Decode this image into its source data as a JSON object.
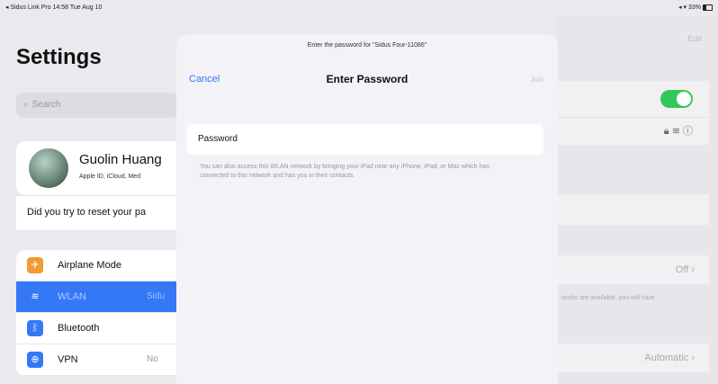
{
  "status_bar": {
    "left": "◂ Sidus Link Pro  14:58  Tue Aug 10",
    "right": "◂ ▾ 33%",
    "battery_icon": "battery-icon"
  },
  "sidebar": {
    "title": "Settings",
    "search_placeholder": "Search",
    "profile": {
      "name": "Guolin Huang",
      "subtitle": "Apple ID, iCloud, Med"
    },
    "suggestion": "Did you try to reset your pa",
    "items": [
      {
        "label": "Airplane Mode",
        "value": "",
        "icon": "airplane-icon",
        "color": "#f29b30",
        "glyph": "✈"
      },
      {
        "label": "WLAN",
        "value": "Sidu",
        "icon": "wifi-icon",
        "color": "#3478f6",
        "glyph": "≋"
      },
      {
        "label": "Bluetooth",
        "value": "",
        "icon": "bluetooth-icon",
        "color": "#3478f6",
        "glyph": "ᛒ"
      },
      {
        "label": "VPN",
        "value": "No",
        "icon": "vpn-icon",
        "color": "#3478f6",
        "glyph": "⊕"
      }
    ]
  },
  "detail": {
    "edit": "Edit",
    "ask_to_join_value": "Off ›",
    "ask_note": "works are available, you will have",
    "auto_join_value": "Automatic ›"
  },
  "modal": {
    "prompt": "Enter the password for \"Sidus Four-11086\"",
    "cancel": "Cancel",
    "title": "Enter Password",
    "join": "Join",
    "password_label": "Password",
    "password_value": "",
    "hint": "You can also access this WLAN network by bringing your iPad near any iPhone, iPad, or Mac which has connected to this network and has you in their contacts."
  }
}
